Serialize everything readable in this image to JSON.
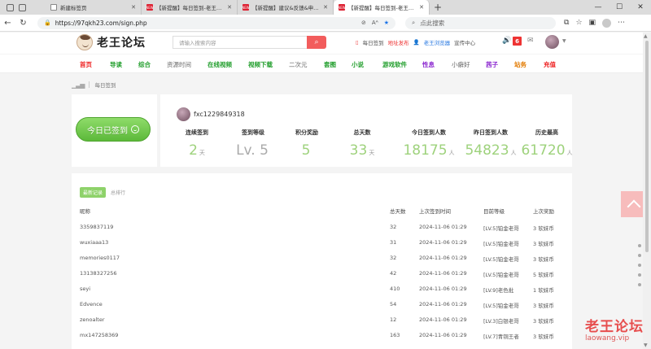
{
  "browser": {
    "tabs": [
      {
        "title": "新建标签页",
        "active": false,
        "icon": "plain"
      },
      {
        "title": "【新提醒】每日签到-老王论坛",
        "active": false,
        "icon": "site"
      },
      {
        "title": "【新提醒】建议&反馈&申请区-老王论坛",
        "active": false,
        "icon": "site"
      },
      {
        "title": "【新提醒】每日签到-老王论坛",
        "active": true,
        "icon": "site"
      }
    ],
    "url": "https://97qkh23.com/sign.php",
    "search_placeholder": "点此搜索",
    "colors": {
      "tab_bar": "#dcdcdc",
      "address": "#f1f3f4"
    }
  },
  "site": {
    "logo_text": "老王论坛",
    "search_placeholder": "请输入搜索内容",
    "header_links": {
      "daily_sign": "每日签到",
      "address_release": "地址发布",
      "app": "老王浏览器",
      "promo": "宣传中心"
    },
    "notice_count": "6",
    "colors": {
      "accent": "#f25c5c",
      "green": "#8ed26a"
    }
  },
  "nav": [
    {
      "label": "首页",
      "color": "red"
    },
    {
      "label": "导读",
      "color": "green"
    },
    {
      "label": "综合",
      "color": "green"
    },
    {
      "label": "资源时间",
      "color": "gray"
    },
    {
      "label": "在线视频",
      "color": "green"
    },
    {
      "label": "视频下载",
      "color": "green"
    },
    {
      "label": "二次元",
      "color": "gray"
    },
    {
      "label": "套图",
      "color": "green"
    },
    {
      "label": "小说",
      "color": "green"
    },
    {
      "label": "游戏软件",
      "color": "green"
    },
    {
      "label": "性息",
      "color": "purple"
    },
    {
      "label": "小癖好",
      "color": "gray"
    },
    {
      "label": "茜子",
      "color": "purple"
    },
    {
      "label": "站务",
      "color": "orange"
    },
    {
      "label": "充值",
      "color": "red"
    }
  ],
  "breadcrumb": {
    "current": "每日签到"
  },
  "sign": {
    "button_label": "今日已签到",
    "username": "fxc1229849318",
    "stats": [
      {
        "label": "连续签到",
        "value": "2",
        "unit": "天"
      },
      {
        "label": "签到等级",
        "value": "Lv. 5",
        "unit": ""
      },
      {
        "label": "积分奖励",
        "value": "5",
        "unit": ""
      },
      {
        "label": "总天数",
        "value": "33",
        "unit": "天"
      },
      {
        "label": "今日签到人数",
        "value": "18175",
        "unit": "人"
      },
      {
        "label": "昨日签到人数",
        "value": "54823",
        "unit": "人"
      },
      {
        "label": "历史最高",
        "value": "61720",
        "unit": "人"
      }
    ]
  },
  "records": {
    "tabs": [
      "最新记录",
      "总排行"
    ],
    "headers": {
      "name": "昵称",
      "days": "总天数",
      "time": "上次签到时间",
      "level": "目前等级",
      "reward": "上次奖励"
    },
    "rows": [
      {
        "name": "3359837119",
        "days": "32",
        "time": "2024-11-06 01:29",
        "level": "[LV.5]铂金老哥",
        "reward": "3 软妹币"
      },
      {
        "name": "wuxiaaa13",
        "days": "31",
        "time": "2024-11-06 01:29",
        "level": "[LV.5]铂金老哥",
        "reward": "3 软妹币"
      },
      {
        "name": "memories0117",
        "days": "32",
        "time": "2024-11-06 01:29",
        "level": "[LV.5]铂金老哥",
        "reward": "3 软妹币"
      },
      {
        "name": "13138327256",
        "days": "42",
        "time": "2024-11-06 01:29",
        "level": "[LV.5]铂金老哥",
        "reward": "5 软妹币"
      },
      {
        "name": "seyi",
        "days": "410",
        "time": "2024-11-06 01:29",
        "level": "[LV.9]老色批",
        "reward": "1 软妹币"
      },
      {
        "name": "Edvence",
        "days": "54",
        "time": "2024-11-06 01:29",
        "level": "[LV.5]铂金老哥",
        "reward": "3 软妹币"
      },
      {
        "name": "zenoalter",
        "days": "12",
        "time": "2024-11-06 01:29",
        "level": "[LV.3]白银老哥",
        "reward": "3 软妹币"
      },
      {
        "name": "mx147258369",
        "days": "163",
        "time": "2024-11-06 01:29",
        "level": "[LV.7]青铜王者",
        "reward": "3 软妹币"
      }
    ]
  },
  "watermark": {
    "cn": "老王论坛",
    "en": "laowang.vip"
  }
}
